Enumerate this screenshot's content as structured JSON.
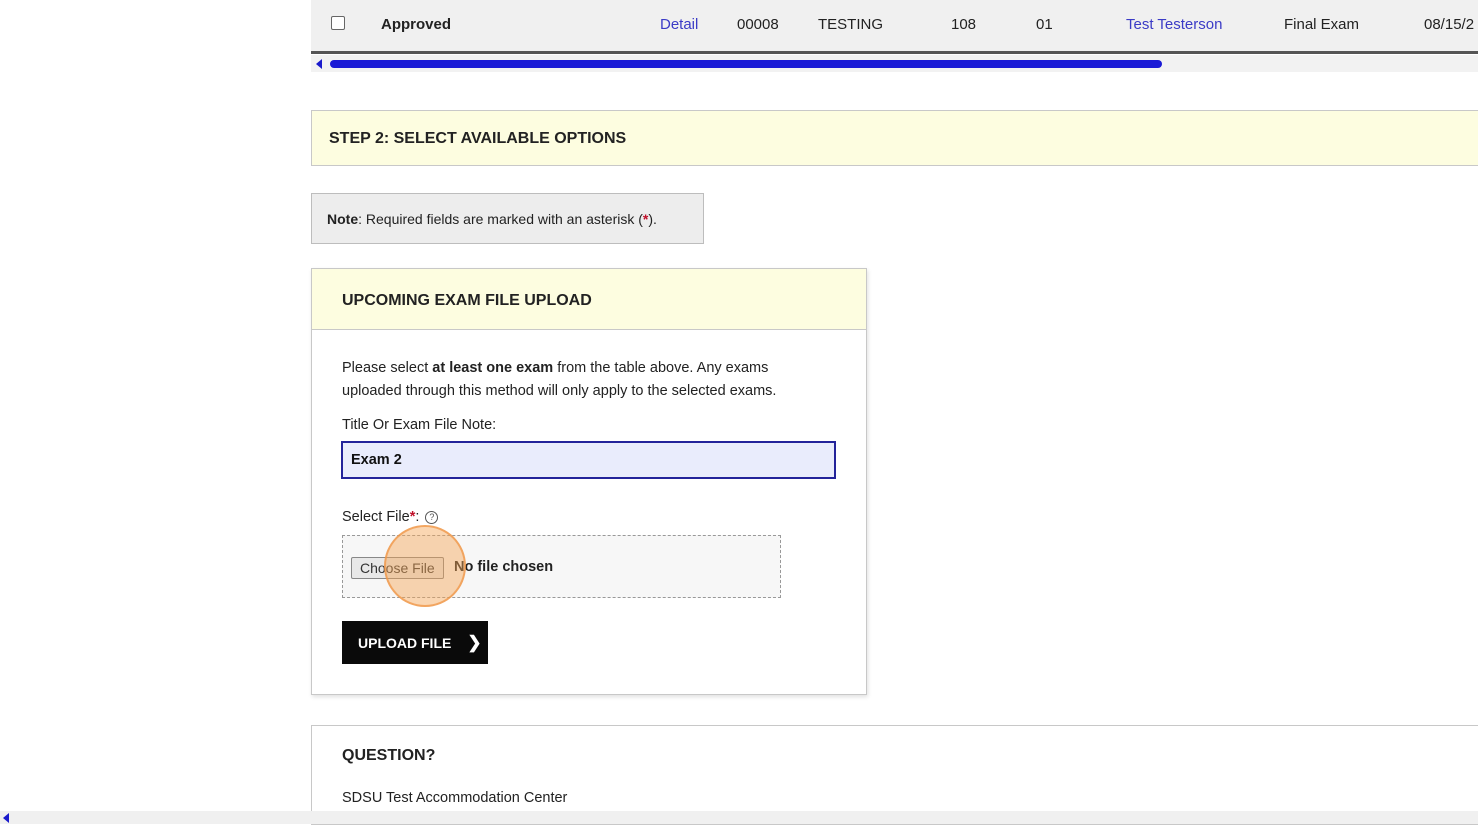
{
  "table": {
    "row": {
      "status": "Approved",
      "detail_link": "Detail",
      "id": "00008",
      "subject": "TESTING",
      "course": "108",
      "section": "01",
      "instructor": "Test Testerson",
      "exam_type": "Final Exam",
      "date": "08/15/2"
    }
  },
  "step2": {
    "title": "STEP 2: SELECT AVAILABLE OPTIONS"
  },
  "note": {
    "label": "Note",
    "text": ": Required fields are marked with an asterisk (",
    "asterisk": "*",
    "end": ")."
  },
  "upload": {
    "title": "UPCOMING EXAM FILE UPLOAD",
    "instructions_pre": "Please select ",
    "instructions_bold": "at least one exam",
    "instructions_post": " from the table above. Any exams uploaded through this method will only apply to the selected exams.",
    "title_label": "Title Or Exam File Note:",
    "title_value": "Exam 2",
    "file_label": "Select File",
    "file_asterisk": "*",
    "file_colon": ":",
    "help_icon": "?",
    "choose_button": "Choose File",
    "no_file_text": "No file chosen",
    "upload_button": "UPLOAD FILE",
    "upload_chevron": "❯"
  },
  "question": {
    "title": "QUESTION?",
    "org": "SDSU Test Accommodation Center"
  },
  "colors": {
    "link": "#3b3bc6",
    "banner": "#fdfde0",
    "asterisk": "#c0102a",
    "input_focus": "#23239a",
    "scroll_thumb": "#1a1ad6",
    "click_highlight": "#f3a454"
  }
}
